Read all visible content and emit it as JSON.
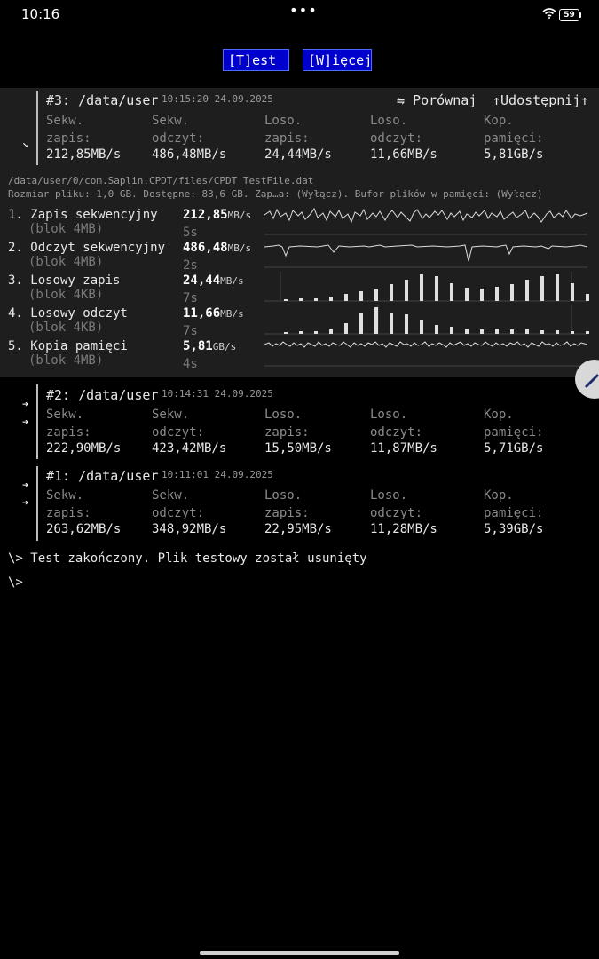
{
  "status_bar": {
    "time": "10:16",
    "dots": "•••",
    "battery": "59"
  },
  "menu": {
    "test_label": "[T]est",
    "more_label": "[W]ięcej"
  },
  "result3": {
    "title": "#3: /data/user",
    "timestamp": "10:15:20 24.09.2025",
    "compare": "⇋ Porównaj",
    "share": "↑Udostępnij↑",
    "collapse_arrow": "↘",
    "cols": [
      {
        "l1": "Sekw.",
        "l2": "zapis:",
        "val": "212,85MB/s"
      },
      {
        "l1": "Sekw.",
        "l2": "odczyt:",
        "val": "486,48MB/s"
      },
      {
        "l1": "Loso.",
        "l2": "zapis:",
        "val": "24,44MB/s"
      },
      {
        "l1": "Loso.",
        "l2": "odczyt:",
        "val": "11,66MB/s"
      },
      {
        "l1": "Kop.",
        "l2": "pamięci:",
        "val": "5,81GB/s"
      }
    ],
    "path": "/data/user/0/com.Saplin.CPDT/files/CPDT_TestFile.dat",
    "info": "Rozmiar pliku: 1,0 GB. Dostępne: 83,6 GB. Zap…a: (Wyłącz). Bufor plików w pamięci: (Wyłącz)",
    "tests": [
      {
        "name": "1. Zapis sekwencyjny",
        "sub": "(blok 4MB)",
        "val": "212,85",
        "unit": "MB/s",
        "time": "5s"
      },
      {
        "name": "2. Odczyt sekwencyjny",
        "sub": "(blok 4MB)",
        "val": "486,48",
        "unit": "MB/s",
        "time": "2s"
      },
      {
        "name": "3. Losowy zapis",
        "sub": "(blok 4KB)",
        "val": "24,44",
        "unit": "MB/s",
        "time": "7s"
      },
      {
        "name": "4. Losowy odczyt",
        "sub": "(blok 4KB)",
        "val": "11,66",
        "unit": "MB/s",
        "time": "7s"
      },
      {
        "name": "5. Kopia pamięci",
        "sub": "(blok 4MB)",
        "val": "5,81",
        "unit": "GB/s",
        "time": "4s"
      }
    ]
  },
  "result2": {
    "title": "#2: /data/user",
    "timestamp": "10:14:31 24.09.2025",
    "arrow": "➔",
    "cols": [
      {
        "l1": "Sekw.",
        "l2": "zapis:",
        "val": "222,90MB/s"
      },
      {
        "l1": "Sekw.",
        "l2": "odczyt:",
        "val": "423,42MB/s"
      },
      {
        "l1": "Loso.",
        "l2": "zapis:",
        "val": "15,50MB/s"
      },
      {
        "l1": "Loso.",
        "l2": "odczyt:",
        "val": "11,87MB/s"
      },
      {
        "l1": "Kop.",
        "l2": "pamięci:",
        "val": "5,71GB/s"
      }
    ]
  },
  "result1": {
    "title": "#1: /data/user",
    "timestamp": "10:11:01 24.09.2025",
    "arrow": "➔",
    "cols": [
      {
        "l1": "Sekw.",
        "l2": "zapis:",
        "val": "263,62MB/s"
      },
      {
        "l1": "Sekw.",
        "l2": "odczyt:",
        "val": "348,92MB/s"
      },
      {
        "l1": "Loso.",
        "l2": "zapis:",
        "val": "22,95MB/s"
      },
      {
        "l1": "Loso.",
        "l2": "odczyt:",
        "val": "11,28MB/s"
      },
      {
        "l1": "Kop.",
        "l2": "pamięci:",
        "val": "5,39GB/s"
      }
    ]
  },
  "console": {
    "line1": "\\> Test zakończony. Plik testowy został usunięty",
    "line2": "\\>"
  }
}
